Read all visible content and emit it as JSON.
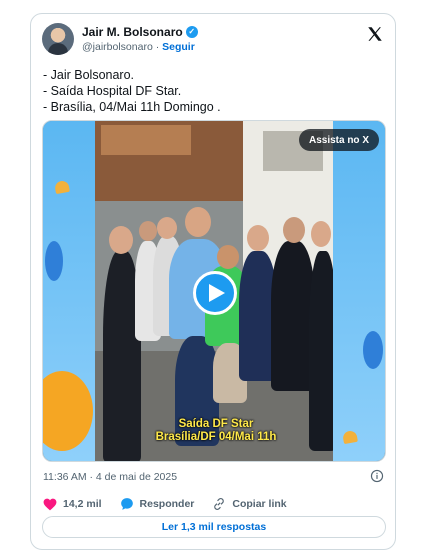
{
  "author": {
    "display_name": "Jair M. Bolsonaro",
    "handle": "@jairbolsonaro",
    "separator": "·",
    "follow_label": "Seguir"
  },
  "tweet": {
    "lines": [
      "- Jair Bolsonaro.",
      "- Saída Hospital DF Star.",
      "- Brasília, 04/Mai 11h Domingo ."
    ]
  },
  "media": {
    "watch_label": "Assista no X",
    "subtitle_line1": "Saída DF Star",
    "subtitle_line2": "Brasília/DF 04/Mai 11h"
  },
  "meta": {
    "timestamp": "11:36 AM · 4 de mai de 2025"
  },
  "actions": {
    "likes": "14,2 mil",
    "reply_label": "Responder",
    "copy_link_label": "Copiar link"
  },
  "replies_button": "Ler 1,3 mil respostas",
  "colors": {
    "accent": "#1d9bf0",
    "link": "#006fd6",
    "heart": "#f91880",
    "muted": "#536471"
  }
}
